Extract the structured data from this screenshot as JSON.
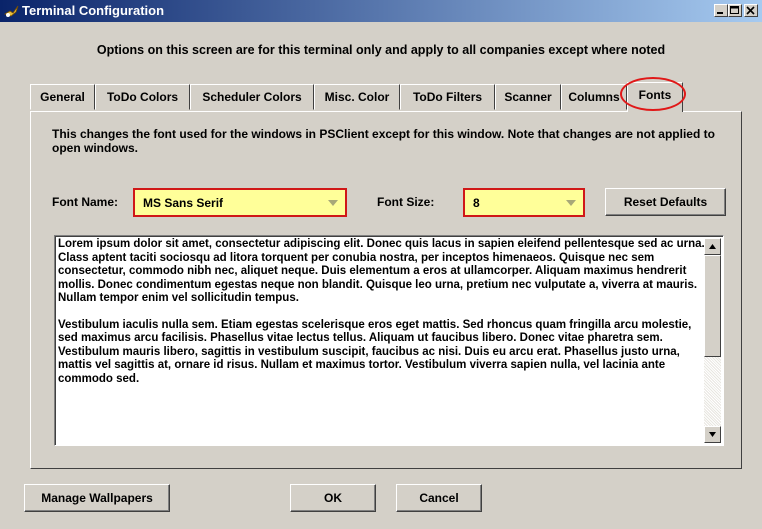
{
  "window": {
    "title": "Terminal Configuration",
    "header_note": "Options on this screen are for this terminal only and apply to all companies except where noted"
  },
  "tabs": [
    {
      "label": "General"
    },
    {
      "label": "ToDo Colors"
    },
    {
      "label": "Scheduler Colors"
    },
    {
      "label": "Misc. Color"
    },
    {
      "label": "ToDo Filters"
    },
    {
      "label": "Scanner"
    },
    {
      "label": "Columns"
    },
    {
      "label": "Fonts",
      "active": true
    }
  ],
  "fonts_panel": {
    "description": "This changes the font used for the windows in PSClient except for this window.  Note that changes are not applied to open windows.",
    "font_name_label": "Font Name:",
    "font_name_value": "MS Sans Serif",
    "font_size_label": "Font Size:",
    "font_size_value": "8",
    "reset_button": "Reset Defaults",
    "preview_paragraphs": [
      "Lorem ipsum dolor sit amet, consectetur adipiscing elit. Donec quis lacus in sapien eleifend pellentesque sed ac urna. Class aptent taciti sociosqu ad litora torquent per conubia nostra, per inceptos himenaeos. Quisque nec sem consectetur, commodo nibh nec, aliquet neque. Duis elementum a eros at ullamcorper. Aliquam maximus hendrerit mollis. Donec condimentum egestas neque non blandit. Quisque leo urna, pretium nec vulputate a, viverra at mauris. Nullam tempor enim vel sollicitudin tempus.",
      "Vestibulum iaculis nulla sem. Etiam egestas scelerisque eros eget mattis. Sed rhoncus quam fringilla arcu molestie, sed maximus arcu facilisis. Phasellus vitae lectus tellus. Aliquam ut faucibus libero. Donec vitae pharetra sem. Vestibulum mauris libero, sagittis in vestibulum suscipit, faucibus ac nisi. Duis eu arcu erat. Phasellus justo urna, mattis vel sagittis at, ornare id risus. Nullam et maximus tortor. Vestibulum viverra sapien nulla, vel lacinia ante commodo sed."
    ]
  },
  "footer": {
    "manage_wallpapers": "Manage Wallpapers",
    "ok": "OK",
    "cancel": "Cancel"
  },
  "colors": {
    "highlight_border": "#d01818",
    "combo_fill": "#ffff99",
    "title_start": "#0a246a",
    "title_end": "#a6caf0"
  }
}
